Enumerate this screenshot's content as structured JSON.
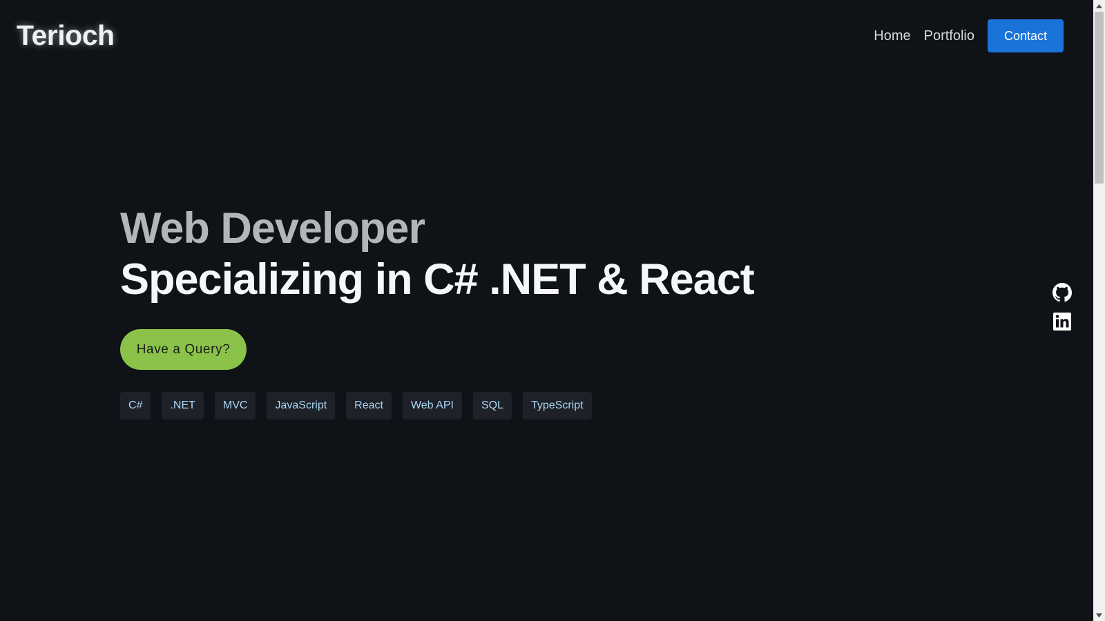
{
  "header": {
    "logo": "Terioch",
    "nav": {
      "home": "Home",
      "portfolio": "Portfolio",
      "contact": "Contact"
    }
  },
  "hero": {
    "line1": "Web Developer",
    "line2": "Specializing in C# .NET & React",
    "cta": "Have a Query?"
  },
  "tags": [
    "C#",
    ".NET",
    "MVC",
    "JavaScript",
    "React",
    "Web API",
    "SQL",
    "TypeScript"
  ],
  "social": {
    "icons": [
      "github-icon",
      "linkedin-icon"
    ]
  },
  "colors": {
    "background": "#0f1217",
    "contact_button": "#1a73d9",
    "cta_button": "#8bc34a",
    "tag_background": "#1e2127",
    "tag_text": "#a9d8f5"
  },
  "scrollbar": {
    "position": 0.0
  }
}
